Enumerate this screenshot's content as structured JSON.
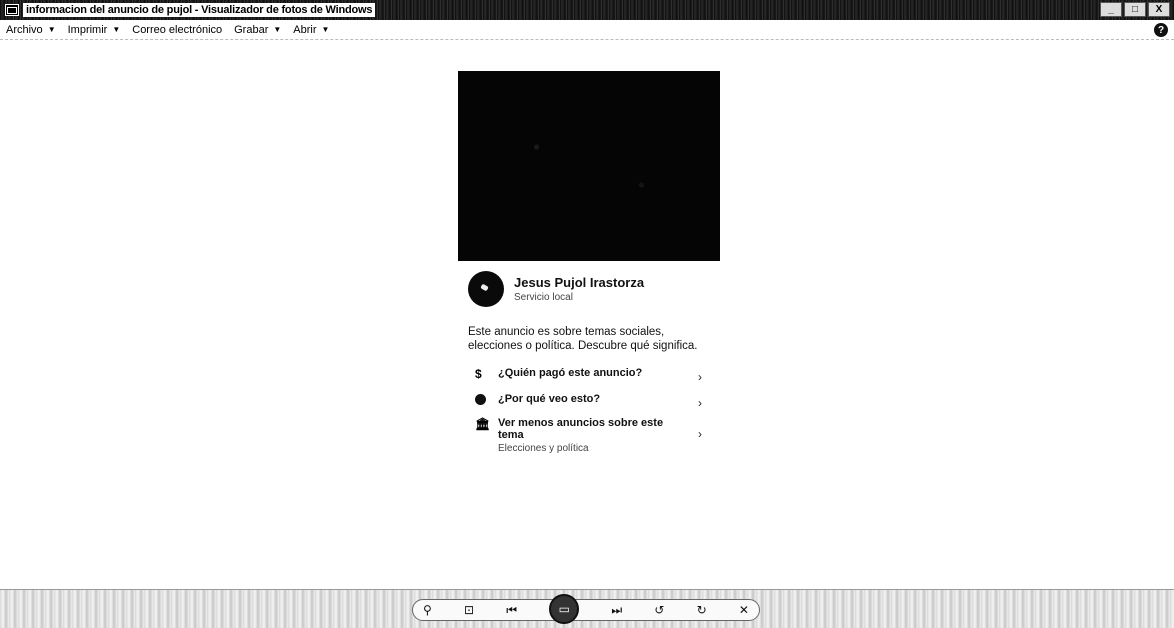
{
  "window": {
    "title": "informacion del anuncio de pujol - Visualizador de fotos de Windows",
    "controls": {
      "minimize": "_",
      "maximize": "□",
      "close": "X"
    }
  },
  "menubar": {
    "items": [
      {
        "label": "Archivo",
        "has_dropdown": true
      },
      {
        "label": "Imprimir",
        "has_dropdown": true
      },
      {
        "label": "Correo electrónico",
        "has_dropdown": false
      },
      {
        "label": "Grabar",
        "has_dropdown": true
      },
      {
        "label": "Abrir",
        "has_dropdown": true
      }
    ],
    "help": "?"
  },
  "ad": {
    "advertiser_name": "Jesus Pujol Irastorza",
    "advertiser_category": "Servicio local",
    "notice": "Este anuncio es sobre temas sociales, elecciones o política. Descubre qué significa.",
    "options": [
      {
        "icon": "dollar-icon",
        "glyph": "$",
        "label": "¿Quién pagó este anuncio?",
        "sub": ""
      },
      {
        "icon": "info-dot-icon",
        "glyph": "",
        "label": "¿Por qué veo esto?",
        "sub": ""
      },
      {
        "icon": "bank-icon",
        "glyph": "🏛",
        "label": "Ver menos anuncios sobre este tema",
        "sub": "Elecciones y política"
      }
    ],
    "chevron": "›"
  },
  "controls": {
    "zoom": "⚲",
    "actual_size": "⊡",
    "prev": "⏮",
    "slideshow": "▭",
    "next": "⏭",
    "rotate_left": "↺",
    "rotate_right": "↻",
    "delete": "✕"
  }
}
